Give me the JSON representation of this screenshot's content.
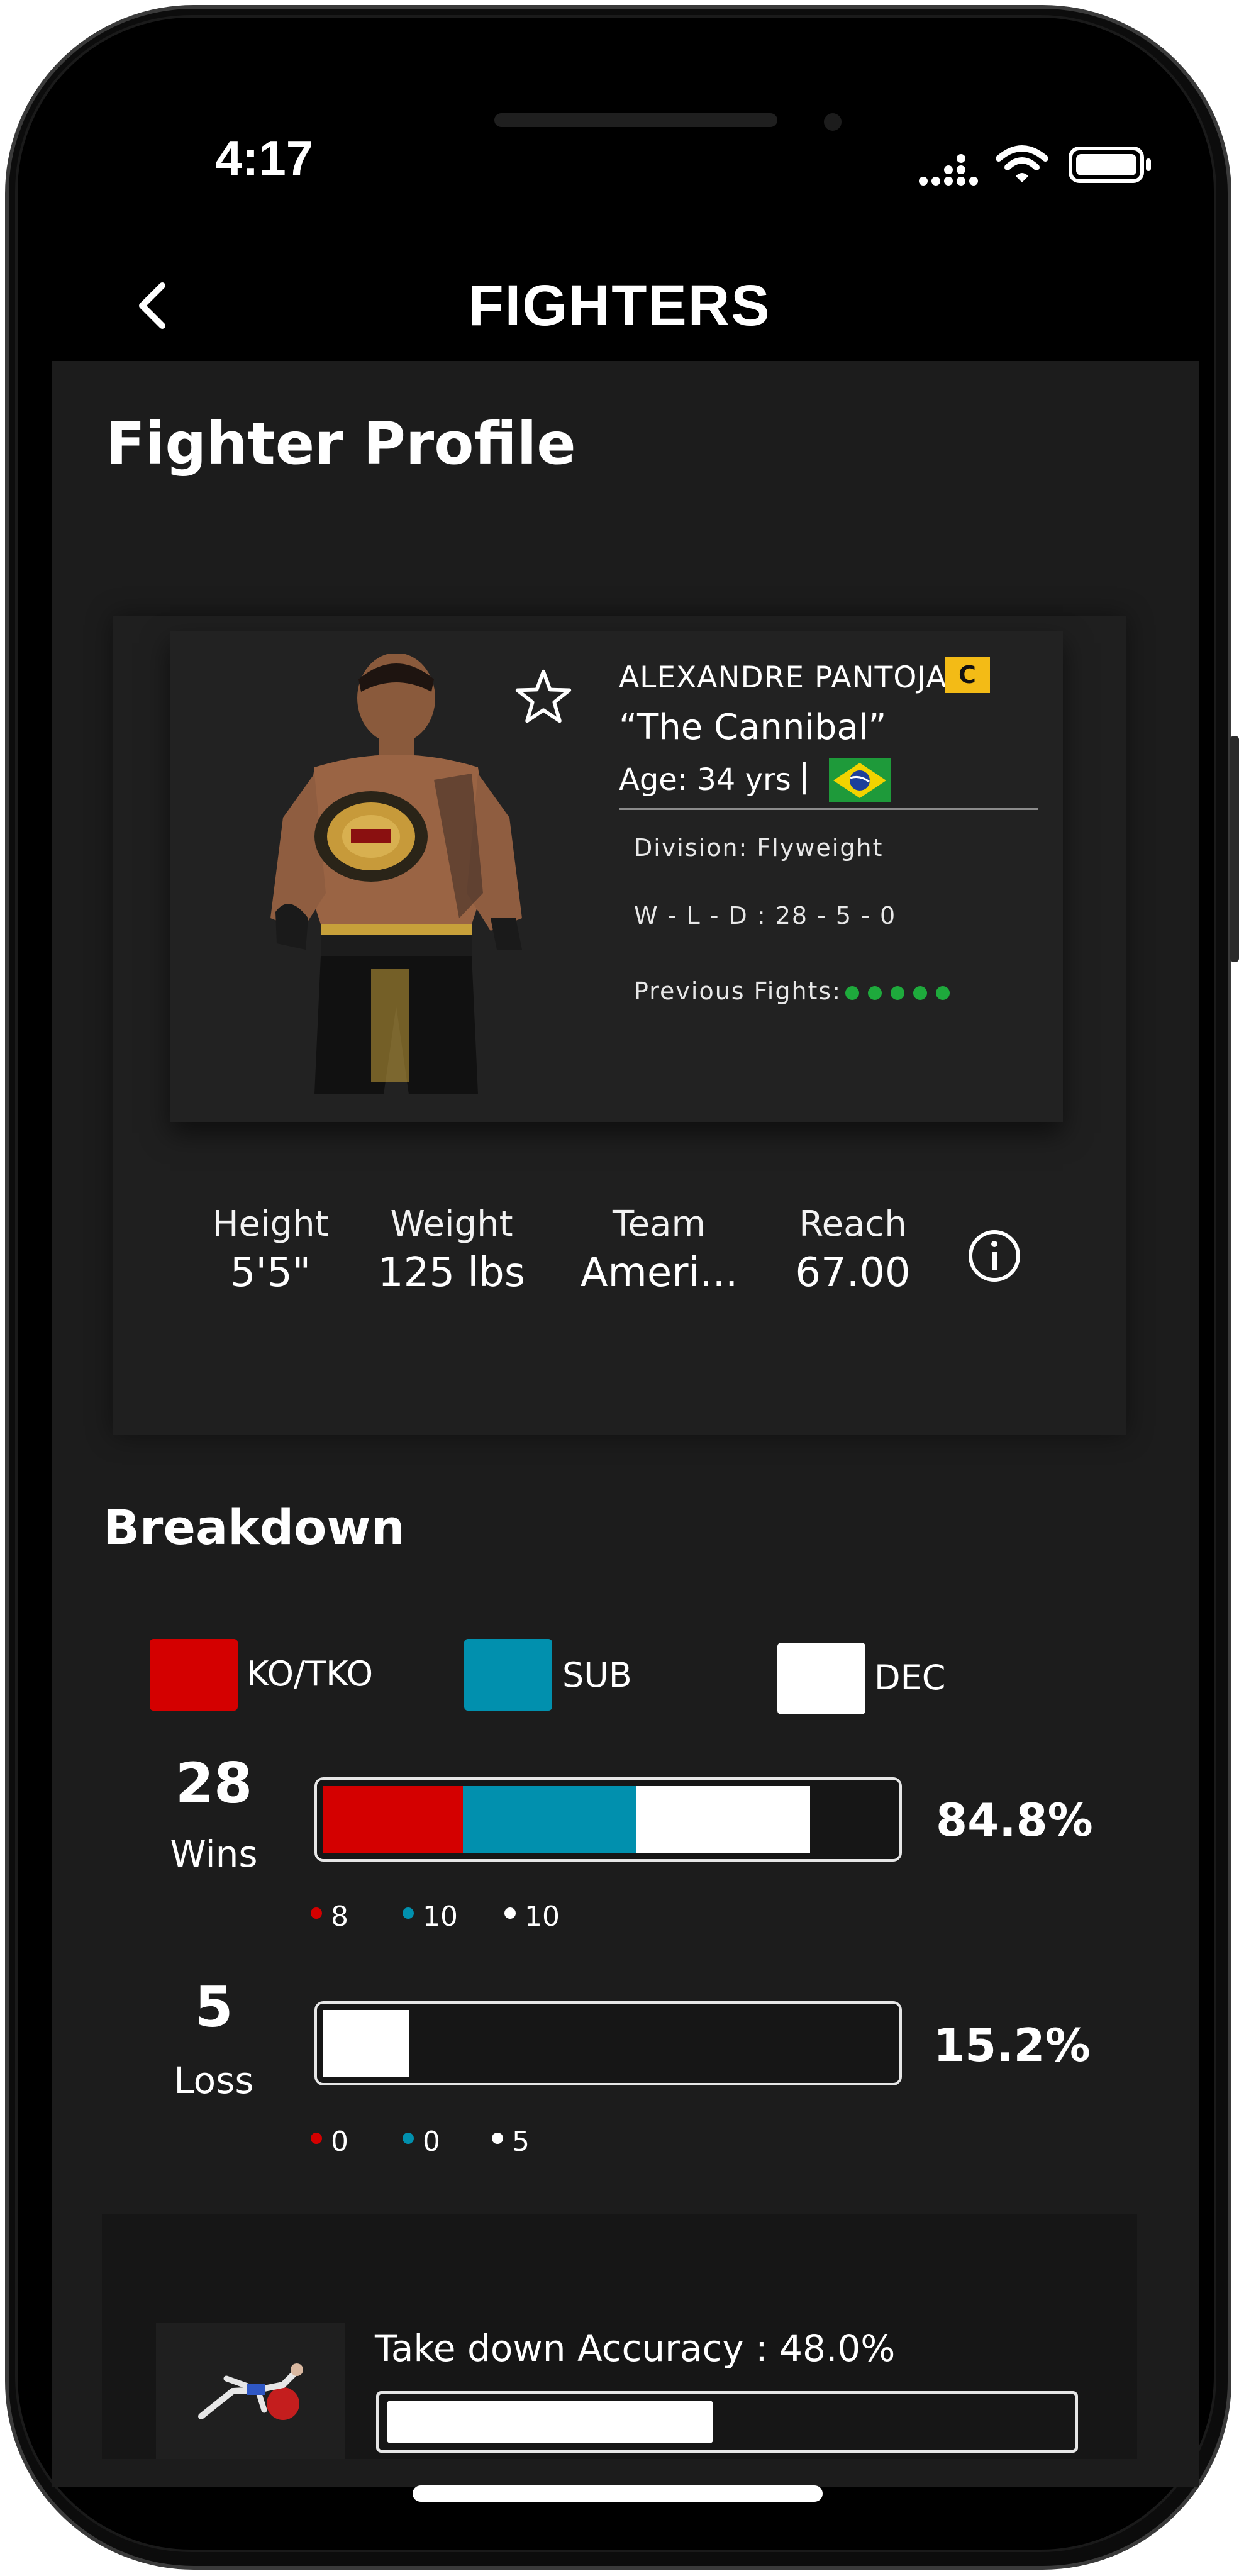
{
  "status_bar": {
    "time": "4:17"
  },
  "header": {
    "title": "FIGHTERS"
  },
  "page": {
    "title": "Fighter Profile"
  },
  "fighter": {
    "name": "ALEXANDRE PANTOJA",
    "champion_badge": "C",
    "nickname": "“The Cannibal”",
    "age": "Age: 34 yrs",
    "age_separator": "|",
    "division": "Division: Flyweight",
    "record": "W - L - D : 28 - 5 - 0",
    "previous_fights_label": "Previous Fights:",
    "previous_fights": [
      "win",
      "win",
      "win",
      "win",
      "win"
    ]
  },
  "stats": [
    {
      "label": "Height",
      "value": "5'5\""
    },
    {
      "label": "Weight",
      "value": "125 lbs"
    },
    {
      "label": "Team",
      "value": "Ameri..."
    },
    {
      "label": "Reach",
      "value": "67.00"
    }
  ],
  "breakdown": {
    "title": "Breakdown",
    "legend": [
      {
        "label": "KO/TKO",
        "color": "#d40000"
      },
      {
        "label": "SUB",
        "color": "#0190ae"
      },
      {
        "label": "DEC",
        "color": "#ffffff"
      }
    ],
    "wins": {
      "count": "28",
      "label": "Wins",
      "percent": "84.8%",
      "ko": "8",
      "sub": "10",
      "dec": "10"
    },
    "loss": {
      "count": "5",
      "label": "Loss",
      "percent": "15.2%",
      "ko": "0",
      "sub": "0",
      "dec": "5"
    }
  },
  "takedown": {
    "label": "Take down Accuracy : 48.0%",
    "value": 0.48
  },
  "icons": [
    "back-chevron-icon",
    "signal-icon",
    "wifi-icon",
    "battery-icon",
    "star-icon",
    "brazil-flag-icon",
    "info-icon",
    "takedown-icon"
  ]
}
